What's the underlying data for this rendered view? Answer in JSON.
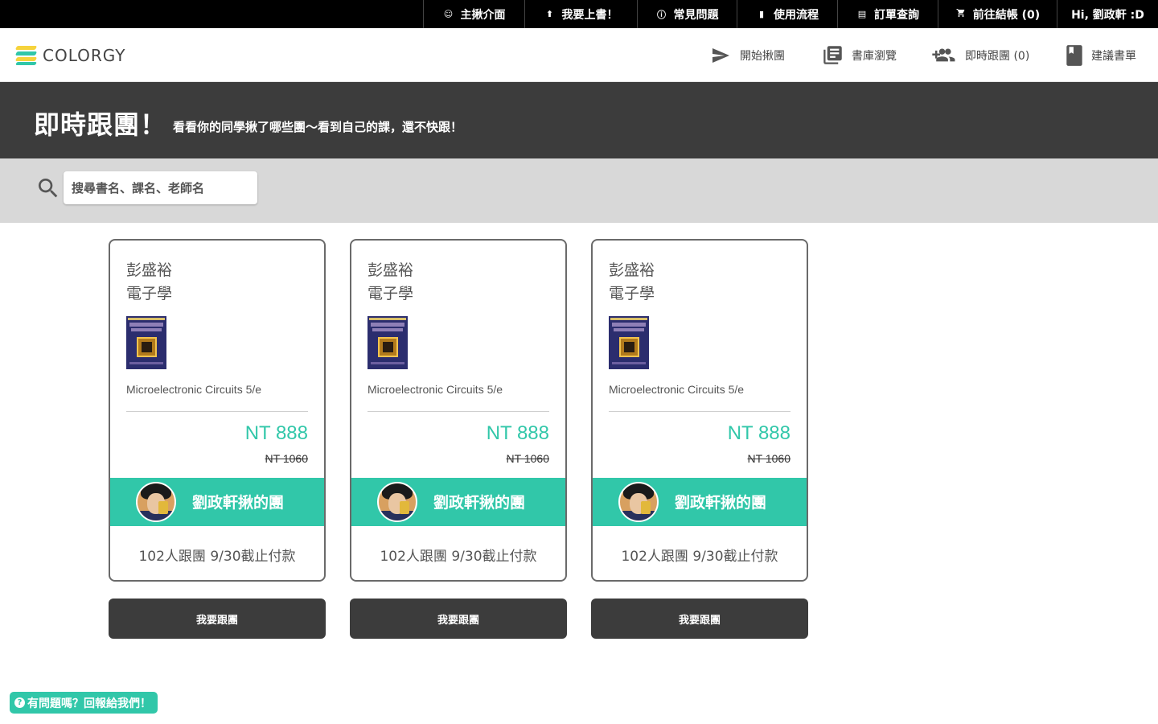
{
  "topbar": {
    "items": [
      {
        "icon": "smile-icon",
        "label": "主揪介面"
      },
      {
        "icon": "upload-icon",
        "label": "我要上書！"
      },
      {
        "icon": "info-icon",
        "label": "常見問題"
      },
      {
        "icon": "film-icon",
        "label": "使用流程"
      },
      {
        "icon": "list-icon",
        "label": "訂單查詢"
      },
      {
        "icon": "cart-icon",
        "label": "前往結帳 (0)"
      },
      {
        "icon": "",
        "label": "Hi, 劉政軒 :D"
      }
    ]
  },
  "nav": {
    "logo_text": "COLORGY",
    "items": [
      {
        "icon": "send-icon",
        "label": "開始揪團"
      },
      {
        "icon": "library-icon",
        "label": "書庫瀏覽"
      },
      {
        "icon": "add-group-icon",
        "label": "即時跟團 (0)"
      },
      {
        "icon": "book-icon",
        "label": "建議書單"
      }
    ]
  },
  "banner": {
    "title": "即時跟團！",
    "subtitle": "看看你的同學揪了哪些團～看到自己的課，還不快跟！"
  },
  "search": {
    "placeholder": "搜尋書名、課名、老師名",
    "value": ""
  },
  "cards": [
    {
      "teacher": "彭盛裕",
      "course": "電子學",
      "book": "Microelectronic Circuits 5/e",
      "price": "NT 888",
      "old_price": "NT 1060",
      "leader": "劉政軒揪的團",
      "status": "102人跟團 9/30截止付款",
      "button": "我要跟團"
    },
    {
      "teacher": "彭盛裕",
      "course": "電子學",
      "book": "Microelectronic Circuits 5/e",
      "price": "NT 888",
      "old_price": "NT 1060",
      "leader": "劉政軒揪的團",
      "status": "102人跟團 9/30截止付款",
      "button": "我要跟團"
    },
    {
      "teacher": "彭盛裕",
      "course": "電子學",
      "book": "Microelectronic Circuits 5/e",
      "price": "NT 888",
      "old_price": "NT 1060",
      "leader": "劉政軒揪的團",
      "status": "102人跟團 9/30截止付款",
      "button": "我要跟團"
    }
  ],
  "feedback": {
    "icon": "question-icon",
    "label": "有問題嗎？回報給我們！"
  },
  "colors": {
    "accent": "#31c7a9",
    "dark": "#3c3c3c",
    "logo_yellow": "#f6d33c"
  }
}
